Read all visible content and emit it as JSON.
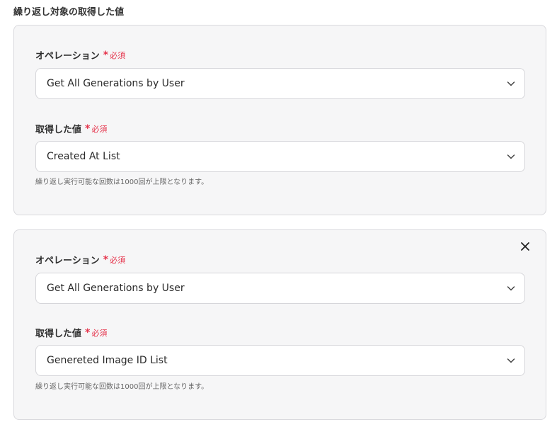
{
  "section_title": "繰り返し対象の取得した値",
  "required_star": "*",
  "required_text": "必須",
  "cards": [
    {
      "operation_label": "オペレーション",
      "operation_value": "Get All Generations by User",
      "value_label": "取得した値",
      "value_selected": "Created At List",
      "help_text": "繰り返し実行可能な回数は1000回が上限となります。"
    },
    {
      "operation_label": "オペレーション",
      "operation_value": "Get All Generations by User",
      "value_label": "取得した値",
      "value_selected": "Genereted Image ID List",
      "help_text": "繰り返し実行可能な回数は1000回が上限となります。"
    }
  ],
  "icons": {
    "dropdown": "chevron-down-icon",
    "close": "close-icon"
  },
  "colors": {
    "required": "#e5334b",
    "card_background": "#f6f6f7",
    "border": "#d9d9dd"
  }
}
